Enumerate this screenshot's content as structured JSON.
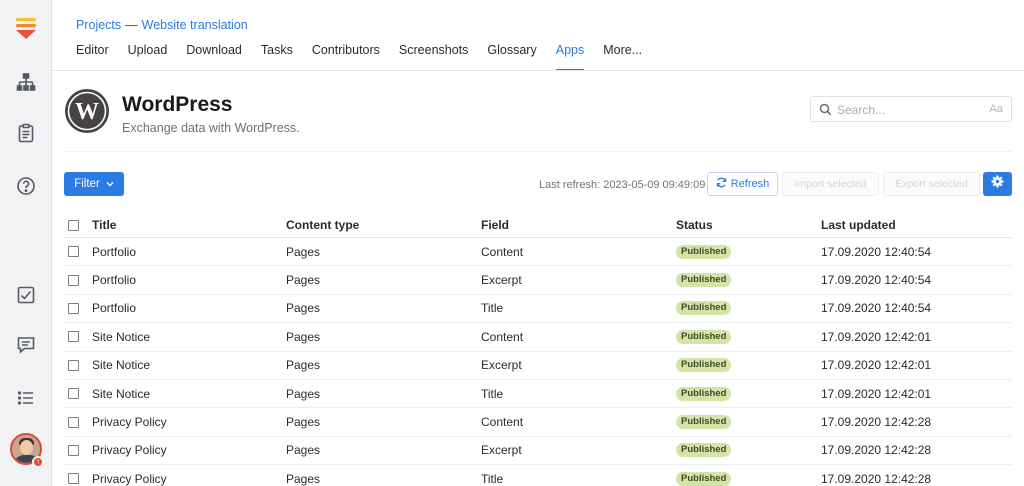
{
  "colors": {
    "accent": "#2a7be4",
    "badge_bg": "#d4e4a9",
    "sidebar_bg": "#f1f2f4"
  },
  "sidebar": {
    "icons": [
      "logo-icon",
      "sitemap-icon",
      "clipboard-icon",
      "help-icon",
      "checkbox-icon",
      "comment-icon",
      "list-icon",
      "avatar"
    ]
  },
  "breadcrumb": {
    "root": "Projects",
    "separator": "—",
    "current": "Website translation"
  },
  "tabs": [
    {
      "label": "Editor",
      "active": false
    },
    {
      "label": "Upload",
      "active": false
    },
    {
      "label": "Download",
      "active": false
    },
    {
      "label": "Tasks",
      "active": false
    },
    {
      "label": "Contributors",
      "active": false
    },
    {
      "label": "Screenshots",
      "active": false
    },
    {
      "label": "Glossary",
      "active": false
    },
    {
      "label": "Apps",
      "active": true
    },
    {
      "label": "More...",
      "active": false
    }
  ],
  "app": {
    "title": "WordPress",
    "subtitle": "Exchange data with WordPress."
  },
  "search": {
    "placeholder": "Search...",
    "case_label": "Aa"
  },
  "toolbar": {
    "filter_label": "Filter",
    "last_refresh": "Last refresh: 2023-05-09 09:49:09",
    "refresh_label": "Refresh",
    "import_label": "Import selected",
    "export_label": "Export selected"
  },
  "table": {
    "headers": {
      "title": "Title",
      "type": "Content type",
      "field": "Field",
      "status": "Status",
      "updated": "Last updated"
    },
    "rows": [
      {
        "title": "Portfolio",
        "type": "Pages",
        "field": "Content",
        "status": "Published",
        "updated": "17.09.2020 12:40:54"
      },
      {
        "title": "Portfolio",
        "type": "Pages",
        "field": "Excerpt",
        "status": "Published",
        "updated": "17.09.2020 12:40:54"
      },
      {
        "title": "Portfolio",
        "type": "Pages",
        "field": "Title",
        "status": "Published",
        "updated": "17.09.2020 12:40:54"
      },
      {
        "title": "Site Notice",
        "type": "Pages",
        "field": "Content",
        "status": "Published",
        "updated": "17.09.2020 12:42:01"
      },
      {
        "title": "Site Notice",
        "type": "Pages",
        "field": "Excerpt",
        "status": "Published",
        "updated": "17.09.2020 12:42:01"
      },
      {
        "title": "Site Notice",
        "type": "Pages",
        "field": "Title",
        "status": "Published",
        "updated": "17.09.2020 12:42:01"
      },
      {
        "title": "Privacy Policy",
        "type": "Pages",
        "field": "Content",
        "status": "Published",
        "updated": "17.09.2020 12:42:28"
      },
      {
        "title": "Privacy Policy",
        "type": "Pages",
        "field": "Excerpt",
        "status": "Published",
        "updated": "17.09.2020 12:42:28"
      },
      {
        "title": "Privacy Policy",
        "type": "Pages",
        "field": "Title",
        "status": "Published",
        "updated": "17.09.2020 12:42:28"
      }
    ]
  }
}
